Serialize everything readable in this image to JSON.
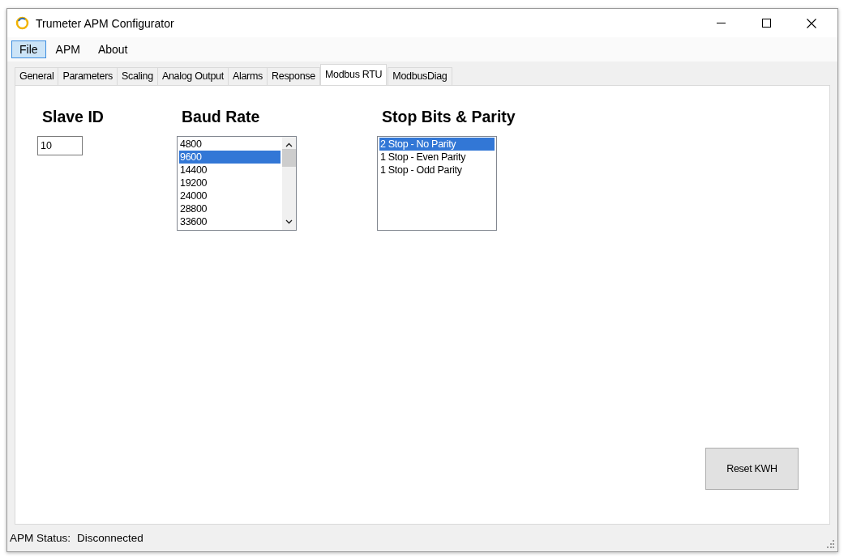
{
  "window": {
    "title": "Trumeter APM Configurator"
  },
  "menu": [
    {
      "label": "File",
      "selected": true
    },
    {
      "label": "APM",
      "selected": false
    },
    {
      "label": "About",
      "selected": false
    }
  ],
  "tabs": [
    {
      "label": "General",
      "selected": false
    },
    {
      "label": "Parameters",
      "selected": false
    },
    {
      "label": "Scaling",
      "selected": false
    },
    {
      "label": "Analog Output",
      "selected": false
    },
    {
      "label": "Alarms",
      "selected": false
    },
    {
      "label": "Response",
      "selected": false
    },
    {
      "label": "Modbus RTU",
      "selected": true
    },
    {
      "label": "ModbusDiag",
      "selected": false
    }
  ],
  "slave_id": {
    "label": "Slave ID",
    "value": "10"
  },
  "baud_rate": {
    "label": "Baud Rate",
    "items": [
      {
        "label": "4800",
        "selected": false
      },
      {
        "label": "9600",
        "selected": true
      },
      {
        "label": "14400",
        "selected": false
      },
      {
        "label": "19200",
        "selected": false
      },
      {
        "label": "24000",
        "selected": false
      },
      {
        "label": "28800",
        "selected": false
      },
      {
        "label": "33600",
        "selected": false
      }
    ]
  },
  "stop_bits_parity": {
    "label": "Stop Bits & Parity",
    "items": [
      {
        "label": "2 Stop - No Parity",
        "selected": true
      },
      {
        "label": "1 Stop - Even Parity",
        "selected": false
      },
      {
        "label": "1 Stop - Odd Parity",
        "selected": false
      }
    ]
  },
  "reset_button": {
    "label": "Reset KWH"
  },
  "status_bar": {
    "label": "APM Status:",
    "value": "Disconnected"
  }
}
